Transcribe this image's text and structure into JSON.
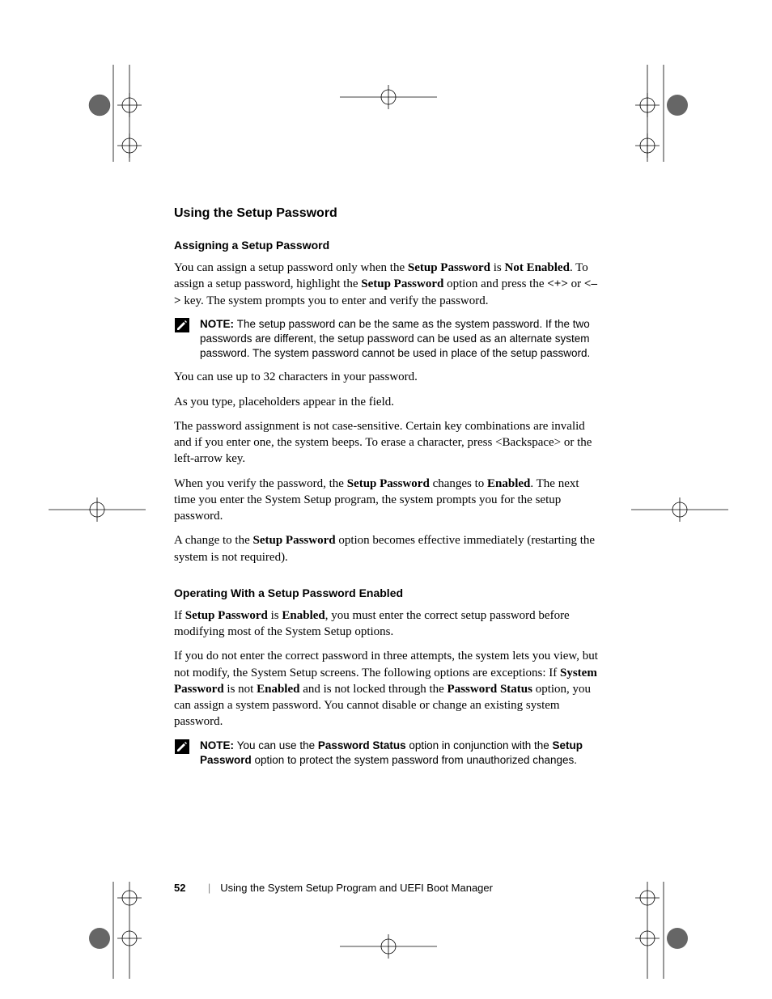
{
  "heading_main": "Using the Setup Password",
  "section1": {
    "heading": "Assigning a Setup Password",
    "p1_a": "You can assign a setup password only when the ",
    "p1_b": "Setup Password",
    "p1_c": " is ",
    "p1_d": "Not Enabled",
    "p1_e": ". To assign a setup password, highlight the ",
    "p1_f": "Setup Password",
    "p1_g": " option and press the ",
    "p1_h": "<+>",
    "p1_i": " or ",
    "p1_j": "<–>",
    "p1_k": " key. The system prompts you to enter and verify the password.",
    "note1_label": "NOTE: ",
    "note1_text": "The setup password can be the same as the system password. If the two passwords are different, the setup password can be used as an alternate system password. The system password cannot be used in place of the setup password.",
    "p2": "You can use up to 32 characters in your password.",
    "p3": "As you type, placeholders appear in the field.",
    "p4": "The password assignment is not case-sensitive. Certain key combinations are invalid and if you enter one, the system beeps. To erase a character, press <Backspace> or the left-arrow key.",
    "p5_a": "When you verify the password, the ",
    "p5_b": "Setup Password",
    "p5_c": " changes to ",
    "p5_d": "Enabled",
    "p5_e": ". The next time you enter the System Setup program, the system prompts you for the setup password.",
    "p6_a": "A change to the ",
    "p6_b": "Setup Password",
    "p6_c": " option becomes effective immediately (restarting the system is not required)."
  },
  "section2": {
    "heading": "Operating With a Setup Password Enabled",
    "p1_a": "If ",
    "p1_b": "Setup Password",
    "p1_c": " is ",
    "p1_d": "Enabled",
    "p1_e": ", you must enter the correct setup password before modifying most of the System Setup options.",
    "p2_a": "If you do not enter the correct password in three attempts, the system lets you view, but not modify, the System Setup screens. The following options are exceptions: If ",
    "p2_b": "System Password",
    "p2_c": " is not ",
    "p2_d": "Enabled",
    "p2_e": " and is not locked through the ",
    "p2_f": "Password Status",
    "p2_g": " option, you can assign a system password. You cannot disable or change an existing system password.",
    "note2_label": "NOTE: ",
    "note2_a": "You can use the ",
    "note2_b": "Password Status",
    "note2_c": " option in conjunction with the ",
    "note2_d": "Setup Password",
    "note2_e": " option to protect the system password from unauthorized changes."
  },
  "footer": {
    "page_number": "52",
    "separator": "|",
    "chapter": "Using the System Setup Program and UEFI Boot Manager"
  }
}
